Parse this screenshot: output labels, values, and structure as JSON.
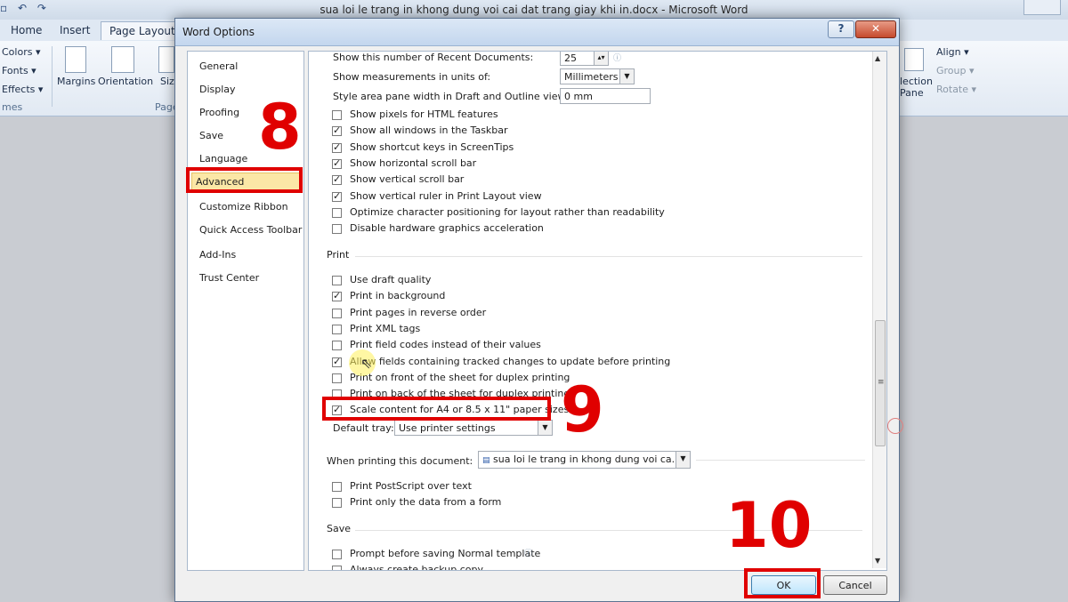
{
  "word": {
    "title": "sua loi le trang in khong dung voi cai dat trang giay khi in.docx - Microsoft Word",
    "tabs": [
      "Home",
      "Insert",
      "Page Layout"
    ],
    "ribbon": {
      "colors": "Colors ▾",
      "fonts": "Fonts ▾",
      "effects": "Effects ▾",
      "themes_group": "mes",
      "margins": "Margins",
      "orientation": "Orientation",
      "size": "Siz",
      "page_group": "Page",
      "selection_pane_1": "lection",
      "selection_pane_2": "Pane",
      "align": "Align ▾",
      "group": "Group ▾",
      "rotate": "Rotate ▾"
    }
  },
  "dialog": {
    "title": "Word Options",
    "help_label": "?",
    "close_label": "✕",
    "nav": [
      {
        "label": "General"
      },
      {
        "label": "Display"
      },
      {
        "label": "Proofing"
      },
      {
        "label": "Save"
      },
      {
        "label": "Language"
      },
      {
        "label": "Advanced",
        "selected": true
      },
      {
        "label": "Customize Ribbon"
      },
      {
        "label": "Quick Access Toolbar"
      },
      {
        "label": "Add-Ins"
      },
      {
        "label": "Trust Center"
      }
    ],
    "display": {
      "recent_docs_label": "Show this number of Recent Documents:",
      "recent_docs_value": "25",
      "units_label": "Show measurements in units of:",
      "units_value": "Millimeters",
      "style_area_label": "Style area pane width in Draft and Outline views:",
      "style_area_value": "0 mm",
      "options": [
        {
          "label": "Show pixels for HTML features",
          "checked": false
        },
        {
          "label": "Show all windows in the Taskbar",
          "checked": true
        },
        {
          "label": "Show shortcut keys in ScreenTips",
          "checked": true
        },
        {
          "label": "Show horizontal scroll bar",
          "checked": true
        },
        {
          "label": "Show vertical scroll bar",
          "checked": true
        },
        {
          "label": "Show vertical ruler in Print Layout view",
          "checked": true
        },
        {
          "label": "Optimize character positioning for layout rather than readability",
          "checked": false
        },
        {
          "label": "Disable hardware graphics acceleration",
          "checked": false
        }
      ]
    },
    "print": {
      "heading": "Print",
      "options": [
        {
          "label": "Use draft quality",
          "checked": false
        },
        {
          "label": "Print in background",
          "checked": true
        },
        {
          "label": "Print pages in reverse order",
          "checked": false
        },
        {
          "label": "Print XML tags",
          "checked": false
        },
        {
          "label": "Print field codes instead of their values",
          "checked": false
        },
        {
          "label": "Allow fields containing tracked changes to update before printing",
          "checked": true
        },
        {
          "label": "Print on front of the sheet for duplex printing",
          "checked": false
        },
        {
          "label": "Print on back of the sheet for duplex printing",
          "checked": false
        },
        {
          "label": "Scale content for A4 or 8.5 x 11\" paper sizes",
          "checked": true
        }
      ],
      "tray_label": "Default tray:",
      "tray_value": "Use printer settings"
    },
    "when_printing": {
      "heading": "When printing this document:",
      "document_value": "sua loi le trang in khong dung voi ca...",
      "options": [
        {
          "label": "Print PostScript over text",
          "checked": false
        },
        {
          "label": "Print only the data from a form",
          "checked": false
        }
      ]
    },
    "save": {
      "heading": "Save",
      "options": [
        {
          "label": "Prompt before saving Normal template",
          "checked": false
        },
        {
          "label": "Always create backup copy",
          "checked": false
        }
      ]
    },
    "ok_label": "OK",
    "cancel_label": "Cancel"
  },
  "annotations": {
    "step_8": "8",
    "step_9": "9",
    "step_10": "10"
  }
}
